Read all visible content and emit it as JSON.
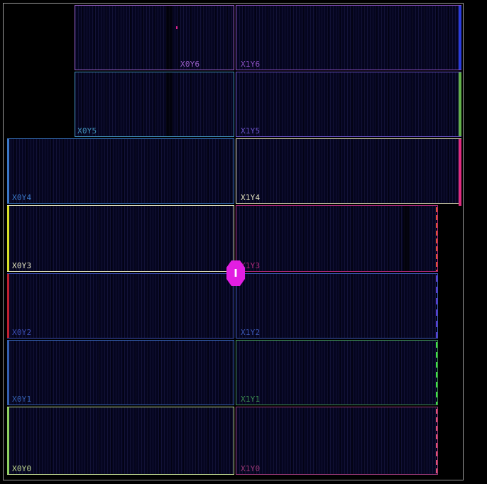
{
  "device_view": {
    "regions": [
      {
        "id": "x0y6",
        "label": "X0Y6",
        "color": "#9a5fc8"
      },
      {
        "id": "x1y6",
        "label": "X1Y6",
        "color": "#8a4fc0"
      },
      {
        "id": "x0y5",
        "label": "X0Y5",
        "color": "#3f8fb8"
      },
      {
        "id": "x1y5",
        "label": "X1Y5",
        "color": "#6a52c8"
      },
      {
        "id": "x0y4",
        "label": "X0Y4",
        "color": "#3a78c8"
      },
      {
        "id": "x1y4",
        "label": "X1Y4",
        "color": "#e4e2bf"
      },
      {
        "id": "x0y3",
        "label": "X0Y3",
        "color": "#e4e4c0"
      },
      {
        "id": "x1y3",
        "label": "X1Y3",
        "color": "#b02a7a"
      },
      {
        "id": "x0y2",
        "label": "X0Y2",
        "color": "#3c4fb8"
      },
      {
        "id": "x1y2",
        "label": "X1Y2",
        "color": "#3c58b8"
      },
      {
        "id": "x0y1",
        "label": "X0Y1",
        "color": "#3460b0"
      },
      {
        "id": "x1y1",
        "label": "X1Y1",
        "color": "#3c8a50"
      },
      {
        "id": "x0y0",
        "label": "X0Y0",
        "color": "#c0d890"
      },
      {
        "id": "x1y0",
        "label": "X1Y0",
        "color": "#9a3878"
      }
    ],
    "edge_colors": {
      "blue": "#2a3cdc",
      "green": "#62b04a",
      "pink": "#e02a80",
      "yellow": "#d8e028",
      "red": "#c02030",
      "lime": "#8ed060",
      "orange": "#e05030",
      "purple": "#5a3ad0",
      "bright_green": "#40e040"
    },
    "marker": {
      "label": "I",
      "color": "#e21ee2"
    }
  }
}
